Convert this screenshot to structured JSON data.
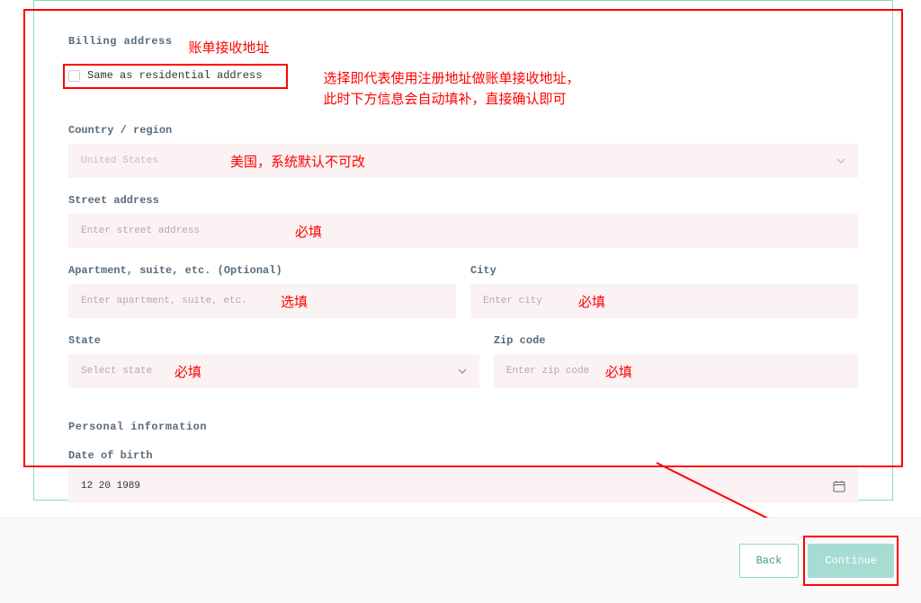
{
  "billing": {
    "title": "Billing address",
    "title_cn": "账单接收地址",
    "same_checkbox_label": "Same as residential address",
    "same_cn_line1": "选择即代表使用注册地址做账单接收地址，",
    "same_cn_line2": "此时下方信息会自动填补，直接确认即可",
    "country_label": "Country / region",
    "country_value": "United States",
    "country_cn": "美国，系统默认不可改",
    "street_label": "Street address",
    "street_placeholder": "Enter street address",
    "street_cn": "必填",
    "apt_label": "Apartment, suite, etc. (Optional)",
    "apt_placeholder": "Enter apartment, suite, etc.",
    "apt_cn": "选填",
    "city_label": "City",
    "city_placeholder": "Enter city",
    "city_cn": "必填",
    "state_label": "State",
    "state_placeholder": "Select state",
    "state_cn": "必填",
    "zip_label": "Zip code",
    "zip_placeholder": "Enter zip code",
    "zip_cn": "必填"
  },
  "personal": {
    "title": "Personal information",
    "dob_label": "Date of birth",
    "dob_value": "12 20 1989"
  },
  "buttons": {
    "back": "Back",
    "continue": "Continue"
  }
}
